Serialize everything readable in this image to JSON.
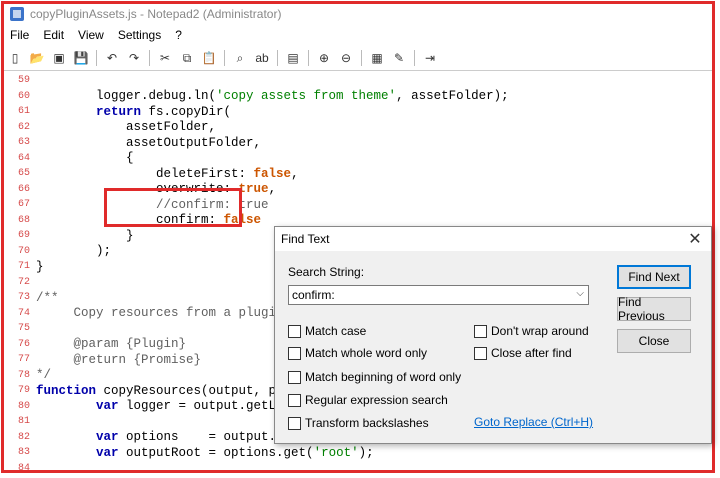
{
  "window": {
    "title": "copyPluginAssets.js - Notepad2 (Administrator)"
  },
  "menu": [
    "File",
    "Edit",
    "View",
    "Settings",
    "?"
  ],
  "toolbar_icons": [
    "new-icon",
    "open-icon",
    "browse-icon",
    "save-icon",
    "sep",
    "undo-icon",
    "redo-icon",
    "sep",
    "cut-icon",
    "copy-icon",
    "paste-icon",
    "sep",
    "find-icon",
    "replace-icon",
    "sep",
    "wordwrap-icon",
    "sep",
    "zoom-in-icon",
    "zoom-out-icon",
    "sep",
    "settings-icon",
    "edit-icon",
    "sep",
    "exit-icon"
  ],
  "code_lines": [
    {
      "n": "59",
      "t": ""
    },
    {
      "n": "60",
      "t": "        logger.debug.ln('copy assets from theme', assetFolder);"
    },
    {
      "n": "61",
      "t": "        return fs.copyDir("
    },
    {
      "n": "62",
      "t": "            assetFolder,"
    },
    {
      "n": "63",
      "t": "            assetOutputFolder,"
    },
    {
      "n": "64",
      "t": "            {"
    },
    {
      "n": "65",
      "t": "                deleteFirst: false,"
    },
    {
      "n": "66",
      "t": "                overwrite: true,"
    },
    {
      "n": "67",
      "t": "                //confirm: true"
    },
    {
      "n": "68",
      "t": "                confirm: false"
    },
    {
      "n": "69",
      "t": "            }"
    },
    {
      "n": "70",
      "t": "        );"
    },
    {
      "n": "71",
      "t": "}"
    },
    {
      "n": "72",
      "t": ""
    },
    {
      "n": "73",
      "t": "/**"
    },
    {
      "n": "74",
      "t": "     Copy resources from a plugin"
    },
    {
      "n": "75",
      "t": ""
    },
    {
      "n": "76",
      "t": "     @param {Plugin}"
    },
    {
      "n": "77",
      "t": "     @return {Promise}"
    },
    {
      "n": "78",
      "t": "*/"
    },
    {
      "n": "79",
      "t": "function copyResources(output, p"
    },
    {
      "n": "80",
      "t": "        var logger = output.getLogger"
    },
    {
      "n": "81",
      "t": ""
    },
    {
      "n": "82",
      "t": "        var options    = output.getOp"
    },
    {
      "n": "83",
      "t": "        var outputRoot = options.get('root');"
    },
    {
      "n": "84",
      "t": ""
    }
  ],
  "find_dialog": {
    "title": "Find Text",
    "search_label": "Search String:",
    "search_value": "confirm:",
    "find_next": "Find Next",
    "find_previous": "Find Previous",
    "close": "Close",
    "options_left": [
      "Match case",
      "Match whole word only",
      "Match beginning of word only",
      "Regular expression search",
      "Transform backslashes"
    ],
    "options_right": [
      "Don't wrap around",
      "Close after find"
    ],
    "goto_replace": "Goto Replace (Ctrl+H)"
  },
  "colors": {
    "highlight": "#e02a2a",
    "line_number": "#d64b4b",
    "keyword": "#0000aa",
    "string": "#008000"
  }
}
